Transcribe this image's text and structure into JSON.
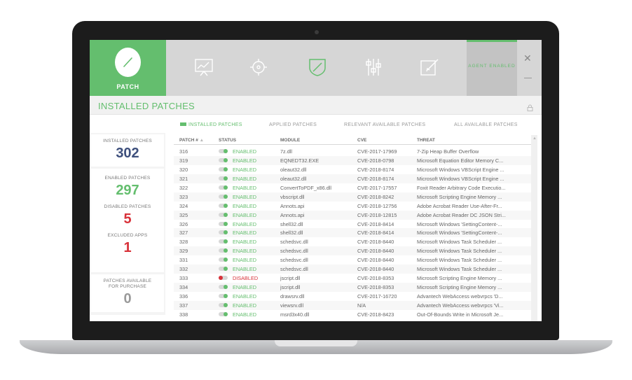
{
  "app": {
    "logo_label": "PATCH",
    "agent_status": "AGENT ENABLED",
    "nav_icons": [
      "chart-icon",
      "settings-icon",
      "shield-icon",
      "sliders-icon",
      "edit-icon"
    ],
    "accent_color": "#64be6e",
    "disabled_color": "#d8323a"
  },
  "page": {
    "title": "INSTALLED PATCHES"
  },
  "tabs": [
    {
      "label": "INSTALLED PATCHES",
      "active": true
    },
    {
      "label": "APPLIED PATCHES",
      "active": false
    },
    {
      "label": "RELEVANT AVAILABLE PATCHES",
      "active": false
    },
    {
      "label": "ALL AVAILABLE PATCHES",
      "active": false
    }
  ],
  "stats": {
    "installed": {
      "label": "INSTALLED PATCHES",
      "value": "302",
      "color": "#3d4f7c"
    },
    "enabled": {
      "label": "ENABLED PATCHES",
      "value": "297",
      "color": "#64be6e"
    },
    "disabled": {
      "label": "DISABLED PATCHES",
      "value": "5",
      "color": "#d8323a"
    },
    "excluded": {
      "label": "EXCLUDED APPS",
      "value": "1",
      "color": "#d8323a"
    },
    "purchase": {
      "label": "PATCHES AVAILABLE FOR PURCHASE",
      "value": "0",
      "color": "#9a9a9a"
    }
  },
  "table": {
    "columns": [
      "PATCH #",
      "STATUS",
      "MODULE",
      "CVE",
      "THREAT"
    ],
    "rows": [
      {
        "patch": "316",
        "status": "ENABLED",
        "module": "7z.dll",
        "cve": "CVE-2017-17969",
        "threat": "7-Zip Heap Buffer Overflow"
      },
      {
        "patch": "319",
        "status": "ENABLED",
        "module": "EQNEDT32.EXE",
        "cve": "CVE-2018-0798",
        "threat": "Microsoft Equation Editor Memory C..."
      },
      {
        "patch": "320",
        "status": "ENABLED",
        "module": "oleaut32.dll",
        "cve": "CVE-2018-8174",
        "threat": "Microsoft Windows VBScript Engine ..."
      },
      {
        "patch": "321",
        "status": "ENABLED",
        "module": "oleaut32.dll",
        "cve": "CVE-2018-8174",
        "threat": "Microsoft Windows VBScript Engine ..."
      },
      {
        "patch": "322",
        "status": "ENABLED",
        "module": "ConvertToPDF_x86.dll",
        "cve": "CVE-2017-17557",
        "threat": "Foxit Reader Arbitrary Code Executio..."
      },
      {
        "patch": "323",
        "status": "ENABLED",
        "module": "vbscript.dll",
        "cve": "CVE-2018-8242",
        "threat": "Microsoft Scripting Engine Memory ..."
      },
      {
        "patch": "324",
        "status": "ENABLED",
        "module": "Annots.api",
        "cve": "CVE-2018-12756",
        "threat": "Adobe Acrobat Reader Use-After-Fr..."
      },
      {
        "patch": "325",
        "status": "ENABLED",
        "module": "Annots.api",
        "cve": "CVE-2018-12815",
        "threat": "Adobe Acrobat Reader DC JSON Stri..."
      },
      {
        "patch": "326",
        "status": "ENABLED",
        "module": "shell32.dll",
        "cve": "CVE-2018-8414",
        "threat": "Microsoft Windows 'SettingContent-..."
      },
      {
        "patch": "327",
        "status": "ENABLED",
        "module": "shell32.dll",
        "cve": "CVE-2018-8414",
        "threat": "Microsoft Windows 'SettingContent-..."
      },
      {
        "patch": "328",
        "status": "ENABLED",
        "module": "schedsvc.dll",
        "cve": "CVE-2018-8440",
        "threat": "Microsoft Windows Task Scheduler ..."
      },
      {
        "patch": "329",
        "status": "ENABLED",
        "module": "schedsvc.dll",
        "cve": "CVE-2018-8440",
        "threat": "Microsoft Windows Task Scheduler ..."
      },
      {
        "patch": "331",
        "status": "ENABLED",
        "module": "schedsvc.dll",
        "cve": "CVE-2018-8440",
        "threat": "Microsoft Windows Task Scheduler ..."
      },
      {
        "patch": "332",
        "status": "ENABLED",
        "module": "schedsvc.dll",
        "cve": "CVE-2018-8440",
        "threat": "Microsoft Windows Task Scheduler ..."
      },
      {
        "patch": "333",
        "status": "DISABLED",
        "module": "jscript.dll",
        "cve": "CVE-2018-8353",
        "threat": "Microsoft Scripting Engine Memory ..."
      },
      {
        "patch": "334",
        "status": "ENABLED",
        "module": "jscript.dll",
        "cve": "CVE-2018-8353",
        "threat": "Microsoft Scripting Engine Memory ..."
      },
      {
        "patch": "336",
        "status": "ENABLED",
        "module": "drawsrv.dll",
        "cve": "CVE-2017-16720",
        "threat": "Advantech WebAccess webvrpcs 'D..."
      },
      {
        "patch": "337",
        "status": "ENABLED",
        "module": "viewsrv.dll",
        "cve": "N/A",
        "threat": "Advantech WebAccess webvrpcs 'Vi..."
      },
      {
        "patch": "338",
        "status": "ENABLED",
        "module": "msrd3x40.dll",
        "cve": "CVE-2018-8423",
        "threat": "Out-Of-Bounds Write in Microsoft Je..."
      }
    ]
  }
}
